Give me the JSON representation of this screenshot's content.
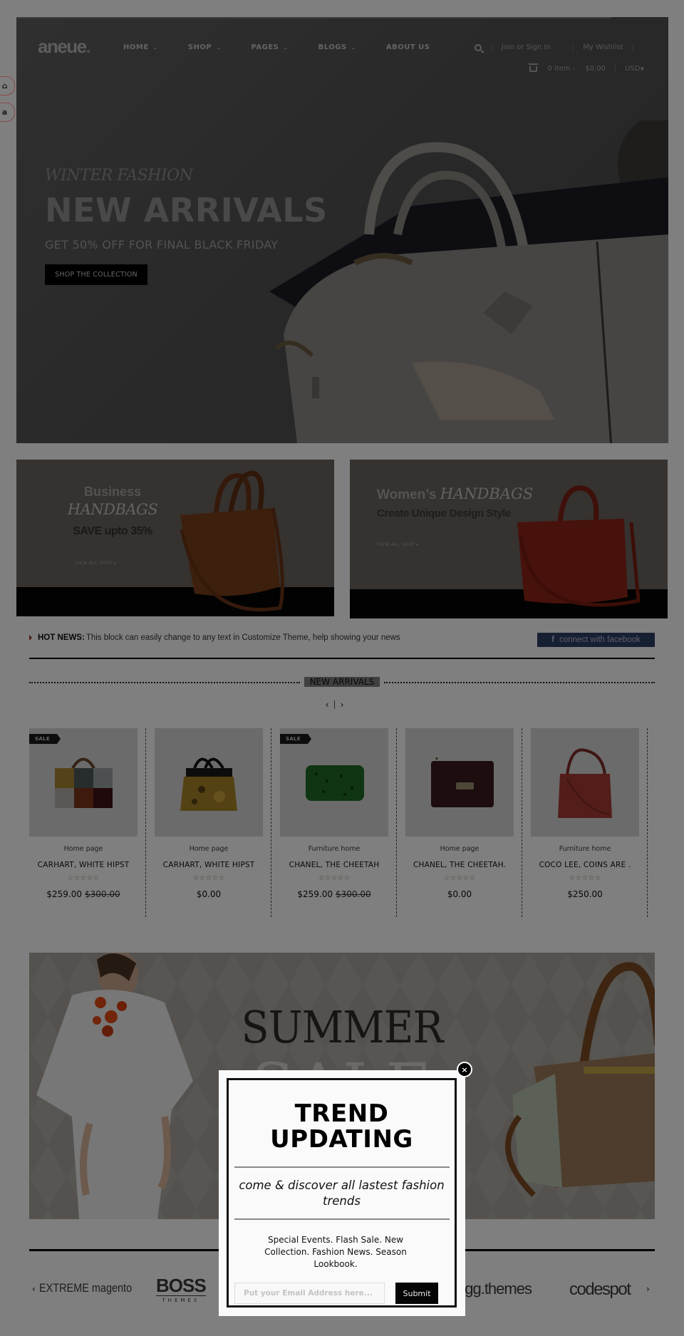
{
  "header": {
    "logo": "aneue",
    "nav": [
      {
        "label": "HOME",
        "has_dropdown": true
      },
      {
        "label": "SHOP",
        "has_dropdown": true
      },
      {
        "label": "PAGES",
        "has_dropdown": true
      },
      {
        "label": "BLOGS",
        "has_dropdown": true
      },
      {
        "label": "ABOUT US",
        "has_dropdown": false
      }
    ],
    "search_icon": "search-icon",
    "join_label": "Join or Sign In",
    "wishlist_label": "My Wishlist",
    "cart_icon": "basket-icon",
    "cart_items": "0 item -",
    "cart_total": "$0.00",
    "currency": "USD"
  },
  "side_widget": {
    "items": [
      {
        "icon": "home-icon",
        "glyph": "⌂"
      },
      {
        "icon": "amazon-icon",
        "glyph": "a"
      }
    ]
  },
  "hero": {
    "subtitle": "WINTER FASHION",
    "title": "NEW ARRIVALS",
    "offer": "GET 50% OFF FOR FINAL BLACK FRIDAY",
    "button": "SHOP THE COLLECTION"
  },
  "promos": [
    {
      "line1": "Business",
      "line2": "HANDBAGS",
      "line3": "SAVE upto 35%",
      "link": "VIEW ALL SHOP",
      "bag_color": "#7a3f1b"
    },
    {
      "line1": "Women’s",
      "line2": "HANDBAGS",
      "line3": "Create Unique Design Style",
      "link": "VIEW ALL SHOP",
      "bag_color": "#8f2416"
    }
  ],
  "news": {
    "label": "HOT NEWS:",
    "text": "This block can easily change to any text in Customize Theme, help showing your news",
    "facebook_glyph": "f",
    "facebook_label": "connect with facebook"
  },
  "new_arrivals": {
    "title": "NEW ARRIVALS",
    "prev": "‹",
    "next": "›",
    "products": [
      {
        "sale": true,
        "badge": "SALE",
        "category": "Home page",
        "name": "CARHART, WHITE HIPST",
        "price": "$259.00",
        "old_price": "$300.00",
        "rating": 0,
        "stars": "☆☆☆☆☆"
      },
      {
        "sale": false,
        "badge": "",
        "category": "Home page",
        "name": "CARHART, WHITE HIPST",
        "price": "$0.00",
        "old_price": "",
        "rating": 0,
        "stars": "☆☆☆☆☆"
      },
      {
        "sale": true,
        "badge": "SALE",
        "category": "Furniture home",
        "name": "CHANEL, THE CHEETAH",
        "price": "$259.00",
        "old_price": "$300.00",
        "rating": 0,
        "stars": "☆☆☆☆☆"
      },
      {
        "sale": false,
        "badge": "",
        "category": "Home page",
        "name": "CHANEL, THE CHEETAH.",
        "price": "$0.00",
        "old_price": "",
        "rating": 0,
        "stars": "☆☆☆☆☆"
      },
      {
        "sale": false,
        "badge": "",
        "category": "Furniture home",
        "name": "COCO LEE, COINS ARE .",
        "price": "$250.00",
        "old_price": "",
        "rating": 0,
        "stars": "☆☆☆☆☆"
      }
    ]
  },
  "summer_banner": {
    "line1": "SUMMER",
    "line2": "SALE"
  },
  "brand_logos": {
    "prev": "‹",
    "next": "›",
    "items": [
      "EXTREME magento",
      "BOSS",
      "THEMES",
      "egg.themes",
      "codespot"
    ]
  },
  "popup": {
    "title_line1": "TREND",
    "title_line2": "UPDATING",
    "tagline": "come & discover all lastest fashion trends",
    "events": "Special Events. Flash Sale. New Collection. Fashion News. Season Lookbook.",
    "email_placeholder": "Put your Email Address here...",
    "email_value": "",
    "submit": "Submit",
    "close_glyph": "×"
  },
  "colors": {
    "facebook": "#2f3f66",
    "sale_badge": "#1a1a1a",
    "accent_arrow": "#a03030",
    "overlay": "rgba(0,0,0,0.5)"
  }
}
